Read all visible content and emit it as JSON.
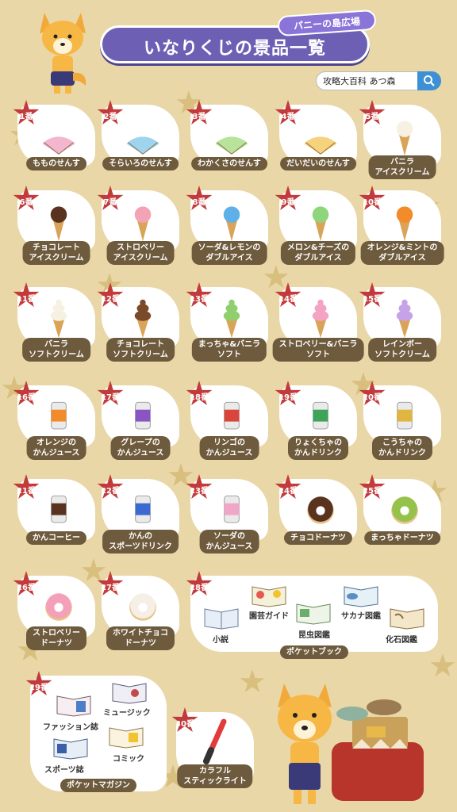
{
  "header": {
    "title": "いなりくじの景品一覧",
    "subtitle": "パニーの島広場",
    "search_text": "攻略大百科 あつ森"
  },
  "items": [
    {
      "no": "1番",
      "l1": "もものせんす",
      "l2": ""
    },
    {
      "no": "2番",
      "l1": "そらいろのせんす",
      "l2": ""
    },
    {
      "no": "3番",
      "l1": "わかくさのせんす",
      "l2": ""
    },
    {
      "no": "4番",
      "l1": "だいだいのせんす",
      "l2": ""
    },
    {
      "no": "5番",
      "l1": "バニラ",
      "l2": "アイスクリーム"
    },
    {
      "no": "6番",
      "l1": "チョコレート",
      "l2": "アイスクリーム"
    },
    {
      "no": "7番",
      "l1": "ストロベリー",
      "l2": "アイスクリーム"
    },
    {
      "no": "8番",
      "l1": "ソーダ&レモンの",
      "l2": "ダブルアイス"
    },
    {
      "no": "9番",
      "l1": "メロン&チーズの",
      "l2": "ダブルアイス"
    },
    {
      "no": "10番",
      "l1": "オレンジ&ミントの",
      "l2": "ダブルアイス"
    },
    {
      "no": "11番",
      "l1": "バニラ",
      "l2": "ソフトクリーム"
    },
    {
      "no": "12番",
      "l1": "チョコレート",
      "l2": "ソフトクリーム"
    },
    {
      "no": "13番",
      "l1": "まっちゃ&バニラ",
      "l2": "ソフト"
    },
    {
      "no": "14番",
      "l1": "ストロベリー&バニラ",
      "l2": "ソフト"
    },
    {
      "no": "15番",
      "l1": "レインボー",
      "l2": "ソフトクリーム"
    },
    {
      "no": "16番",
      "l1": "オレンジの",
      "l2": "かんジュース"
    },
    {
      "no": "17番",
      "l1": "グレープの",
      "l2": "かんジュース"
    },
    {
      "no": "18番",
      "l1": "リンゴの",
      "l2": "かんジュース"
    },
    {
      "no": "19番",
      "l1": "りょくちゃの",
      "l2": "かんドリンク"
    },
    {
      "no": "20番",
      "l1": "こうちゃの",
      "l2": "かんドリンク"
    },
    {
      "no": "21番",
      "l1": "かんコーヒー",
      "l2": ""
    },
    {
      "no": "22番",
      "l1": "かんの",
      "l2": "スポーツドリンク"
    },
    {
      "no": "23番",
      "l1": "ソーダの",
      "l2": "かんジュース"
    },
    {
      "no": "24番",
      "l1": "チョコドーナツ",
      "l2": ""
    },
    {
      "no": "25番",
      "l1": "まっちゃドーナツ",
      "l2": ""
    },
    {
      "no": "26番",
      "l1": "ストロベリー",
      "l2": "ドーナツ"
    },
    {
      "no": "27番",
      "l1": "ホワイトチョコ",
      "l2": "ドーナツ"
    }
  ],
  "pocket_book": {
    "no": "28番",
    "label": "ポケットブック",
    "books": [
      "小説",
      "園芸ガイド",
      "昆虫図鑑",
      "サカナ図鑑",
      "化石図鑑"
    ]
  },
  "pocket_magazine": {
    "no": "29番",
    "label": "ポケットマガジン",
    "mags": [
      "ファッション誌",
      "ミュージック",
      "スポーツ誌",
      "コミック"
    ]
  },
  "stick_light": {
    "no": "30番",
    "l1": "カラフル",
    "l2": "スティックライト"
  },
  "icons": {
    "search": "search-icon",
    "fox": "fox-character-icon"
  },
  "colors": {
    "background": "#e9d7a8",
    "banner": "#6d5fb3",
    "badge": "#c23a3a",
    "label": "#6e5a3c",
    "search_button": "#3d8fd6"
  }
}
